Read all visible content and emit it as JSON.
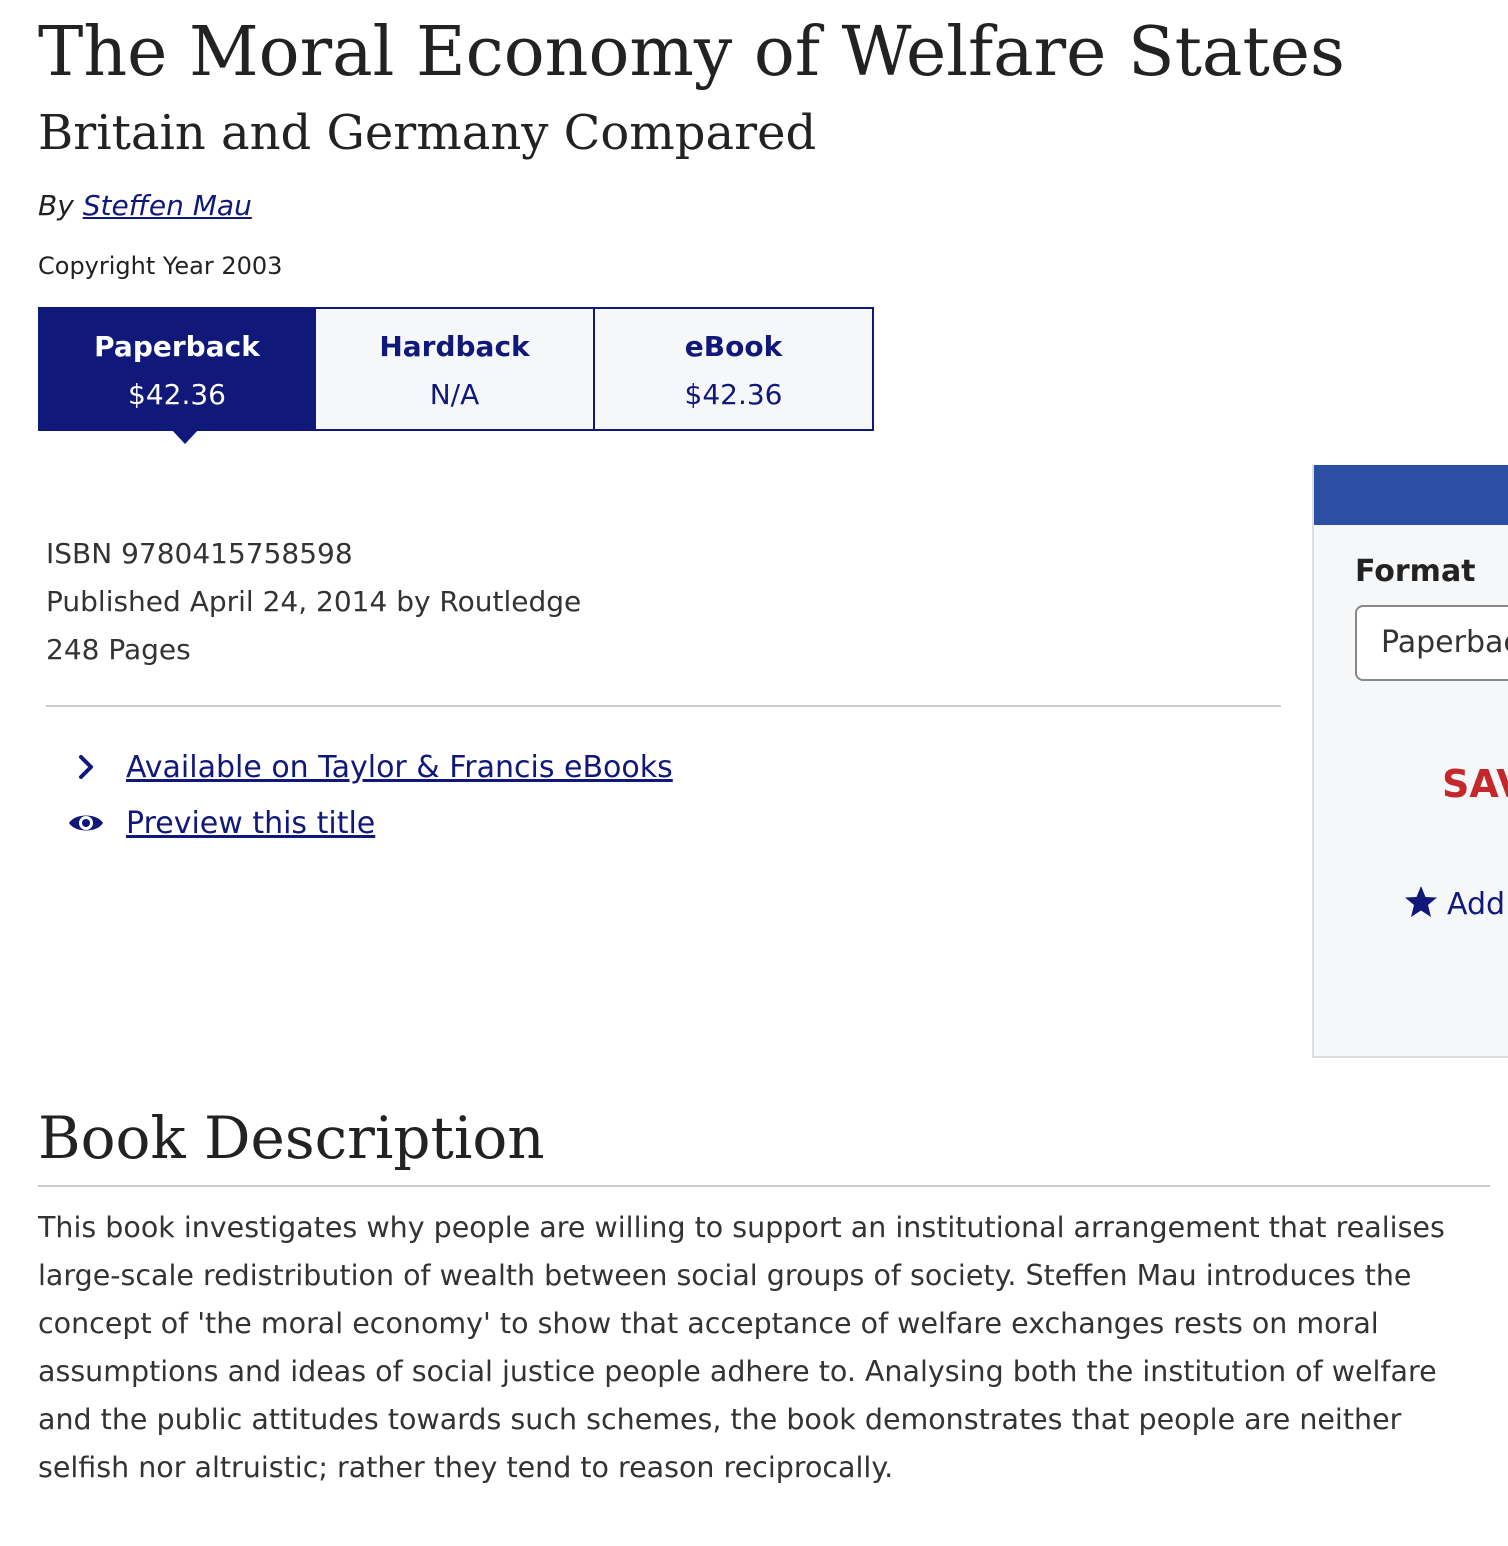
{
  "book": {
    "title": "The Moral Economy of Welfare States",
    "subtitle": "Britain and Germany Compared",
    "by_label": "By",
    "author": "Steffen Mau",
    "copyright": "Copyright Year 2003"
  },
  "formats": [
    {
      "name": "Paperback",
      "price": "$42.36",
      "selected": true
    },
    {
      "name": "Hardback",
      "price": "N/A",
      "selected": false
    },
    {
      "name": "eBook",
      "price": "$42.36",
      "selected": false
    }
  ],
  "details": {
    "isbn": "ISBN 9780415758598",
    "published": "Published April 24, 2014 by Routledge",
    "pages": "248 Pages"
  },
  "links": {
    "ebooks": "Available on Taylor & Francis eBooks",
    "preview": "Preview this title"
  },
  "sidebar": {
    "format_label": "Format",
    "format_value": "Paperback",
    "save_text": "SAV",
    "wishlist_text": "Add"
  },
  "description": {
    "heading": "Book Description",
    "body": "This book investigates why people are willing to support an institutional arrangement that realises large-scale redistribution of wealth between social groups of society. Steffen Mau introduces the concept of 'the moral economy' to show that acceptance of welfare exchanges rests on moral assumptions and ideas of social justice people adhere to. Analysing both the institution of welfare and the public attitudes towards such schemes, the book demonstrates that people are neither selfish nor altruistic; rather they tend to reason reciprocally."
  },
  "colors": {
    "brand_navy": "#10197a",
    "sidebar_header": "#2b4fa3",
    "save_red": "#c4282a"
  },
  "icons": {
    "ebooks": "chevron-right-icon",
    "preview": "eye-icon",
    "wishlist": "star-icon"
  }
}
